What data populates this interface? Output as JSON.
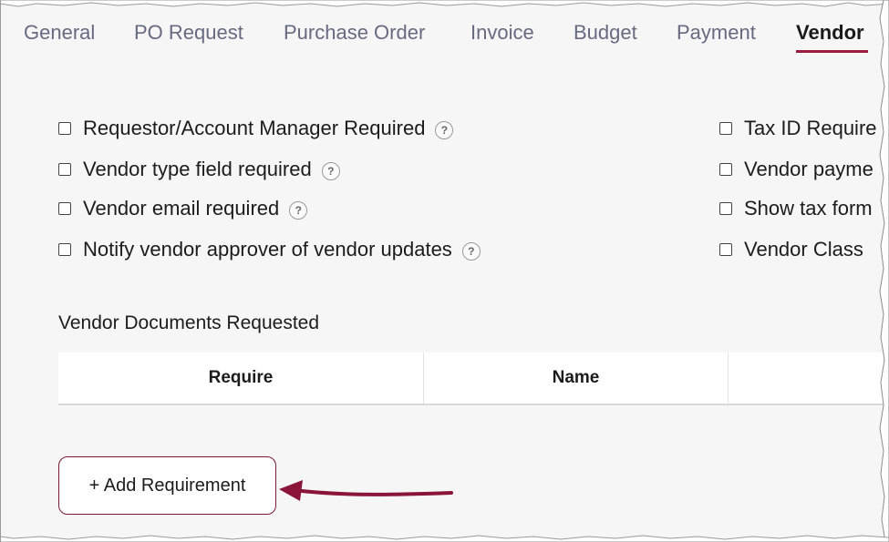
{
  "tabs": [
    {
      "label": "General",
      "active": false
    },
    {
      "label": "PO Request",
      "active": false
    },
    {
      "label": "Purchase Order",
      "active": false
    },
    {
      "label": "Invoice",
      "active": false
    },
    {
      "label": "Budget",
      "active": false
    },
    {
      "label": "Payment",
      "active": false
    },
    {
      "label": "Vendor",
      "active": true
    }
  ],
  "options_left": [
    {
      "label": "Requestor/Account Manager Required",
      "checked": false,
      "help": true
    },
    {
      "label": "Vendor type field required",
      "checked": false,
      "help": true
    },
    {
      "label": "Vendor email required",
      "checked": false,
      "help": true
    },
    {
      "label": "Notify vendor approver of vendor updates",
      "checked": false,
      "help": true
    }
  ],
  "options_right": [
    {
      "label": "Tax ID Require",
      "checked": false
    },
    {
      "label": "Vendor payme",
      "checked": false
    },
    {
      "label": "Show tax form",
      "checked": false
    },
    {
      "label": "Vendor Class",
      "checked": false
    }
  ],
  "help_glyph": "?",
  "documents": {
    "title": "Vendor Documents Requested",
    "columns": [
      "Require",
      "Name",
      ""
    ]
  },
  "add_button": {
    "label": "+ Add Requirement"
  },
  "colors": {
    "accent": "#9b1d3e",
    "annotation_arrow": "#8a1538",
    "tab_inactive": "#676a80",
    "background": "#f6f6f6"
  }
}
